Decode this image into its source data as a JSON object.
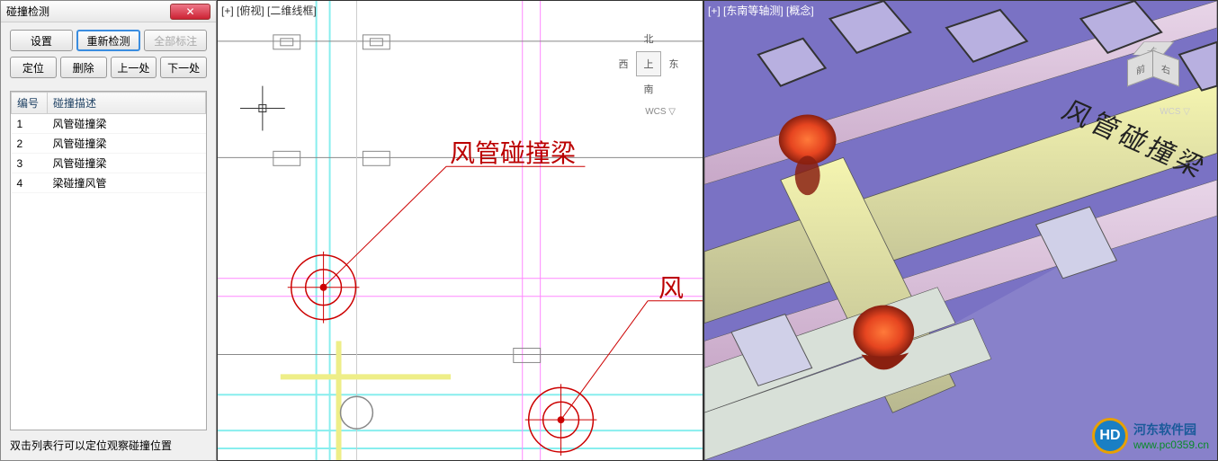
{
  "panel": {
    "title": "碰撞检测",
    "buttons": {
      "settings": "设置",
      "recheck": "重新检测",
      "annotate_all": "全部标注",
      "locate": "定位",
      "delete": "删除",
      "prev": "上一处",
      "next": "下一处"
    },
    "table": {
      "headers": {
        "id": "编号",
        "desc": "碰撞描述"
      },
      "rows": [
        {
          "id": "1",
          "desc": "风管碰撞梁"
        },
        {
          "id": "2",
          "desc": "风管碰撞梁"
        },
        {
          "id": "3",
          "desc": "风管碰撞梁"
        },
        {
          "id": "4",
          "desc": "梁碰撞风管"
        }
      ]
    },
    "hint": "双击列表行可以定位观察碰撞位置"
  },
  "viewport_left": {
    "label": "[+] [俯视] [二维线框]",
    "cube": {
      "n": "北",
      "s": "南",
      "w": "西",
      "e": "东",
      "c": "上"
    },
    "wcs": "WCS ▽",
    "annotation1": "风管碰撞梁",
    "annotation2": "风"
  },
  "viewport_right": {
    "label": "[+] [东南等轴测] [概念]",
    "cube": {
      "top": "上",
      "front": "前",
      "right": "右"
    },
    "wcs": "WCS ▽",
    "annotation": "风管碰撞梁"
  },
  "watermark": {
    "cn": "河东软件园",
    "url": "www.pc0359.cn"
  }
}
